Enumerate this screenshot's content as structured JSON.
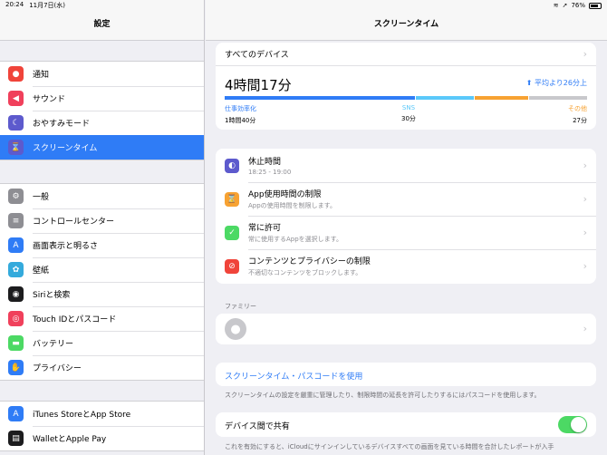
{
  "status": {
    "time": "20:24",
    "date": "11月7日(水)",
    "battery": "76%"
  },
  "sidebar": {
    "title": "設定",
    "groups": [
      [
        {
          "label": "通知",
          "icon": "notification-icon",
          "color": "#f0443a"
        },
        {
          "label": "サウンド",
          "icon": "speaker-icon",
          "color": "#f0405b"
        },
        {
          "label": "おやすみモード",
          "icon": "moon-icon",
          "color": "#5d5acd"
        },
        {
          "label": "スクリーンタイム",
          "icon": "hourglass-icon",
          "color": "#5d5acd",
          "active": true
        }
      ],
      [
        {
          "label": "一般",
          "icon": "gear-icon",
          "color": "#8e8e93"
        },
        {
          "label": "コントロールセンター",
          "icon": "switches-icon",
          "color": "#8e8e93"
        },
        {
          "label": "画面表示と明るさ",
          "icon": "text-size-icon",
          "color": "#2f7cf6"
        },
        {
          "label": "壁紙",
          "icon": "flower-icon",
          "color": "#34aadc"
        },
        {
          "label": "Siriと検索",
          "icon": "siri-icon",
          "color": "#1c1c1e"
        },
        {
          "label": "Touch IDとパスコード",
          "icon": "fingerprint-icon",
          "color": "#f0405b"
        },
        {
          "label": "バッテリー",
          "icon": "battery-icon",
          "color": "#4cd964"
        },
        {
          "label": "プライバシー",
          "icon": "hand-icon",
          "color": "#2f7cf6"
        }
      ],
      [
        {
          "label": "iTunes StoreとApp Store",
          "icon": "app-store-icon",
          "color": "#2f7cf6"
        },
        {
          "label": "WalletとApple Pay",
          "icon": "wallet-icon",
          "color": "#1c1c1e"
        }
      ]
    ]
  },
  "main": {
    "title": "スクリーンタイム",
    "devices_label": "すべてのデバイス",
    "total_usage": "4時間17分",
    "average": "平均より26分上",
    "usage_fractions": {
      "productivity": 0.53,
      "sns": 0.16,
      "other": 0.15,
      "rest": 0.16
    },
    "bar_colors": {
      "productivity": "#2f7cf6",
      "sns": "#5ac8fa",
      "other": "#f7a232",
      "rest": "#c8c8cc"
    },
    "categories": [
      {
        "name": "仕事効率化",
        "time": "1時間40分",
        "color": "#2f7cf6"
      },
      {
        "name": "SNS",
        "time": "30分",
        "color": "#5ac8fa"
      },
      {
        "name": "その他",
        "time": "27分",
        "color": "#f7a232"
      }
    ],
    "options": [
      {
        "title": "休止時間",
        "subtitle": "18:25 - 19:00",
        "icon": "downtime-icon",
        "color": "#5d5acd"
      },
      {
        "title": "App使用時間の制限",
        "subtitle": "Appの使用時間を制限します。",
        "icon": "hourglass-icon",
        "color": "#f7a232"
      },
      {
        "title": "常に許可",
        "subtitle": "常に使用するAppを選択します。",
        "icon": "checkmark-icon",
        "color": "#4cd964"
      },
      {
        "title": "コンテンツとプライバシーの制限",
        "subtitle": "不適切なコンテンツをブロックします。",
        "icon": "restriction-icon",
        "color": "#f0443a"
      }
    ],
    "family_label": "ファミリー",
    "passcode_link": "スクリーンタイム・パスコードを使用",
    "passcode_footer": "スクリーンタイムの設定を厳重に管理したり、制限時間の延長を許可したりするにはパスコードを使用します。",
    "share_label": "デバイス間で共有",
    "share_footer": "これを有効にすると、iCloudにサインインしているデバイスすべての画面を見ている時間を合計したレポートが入手"
  }
}
